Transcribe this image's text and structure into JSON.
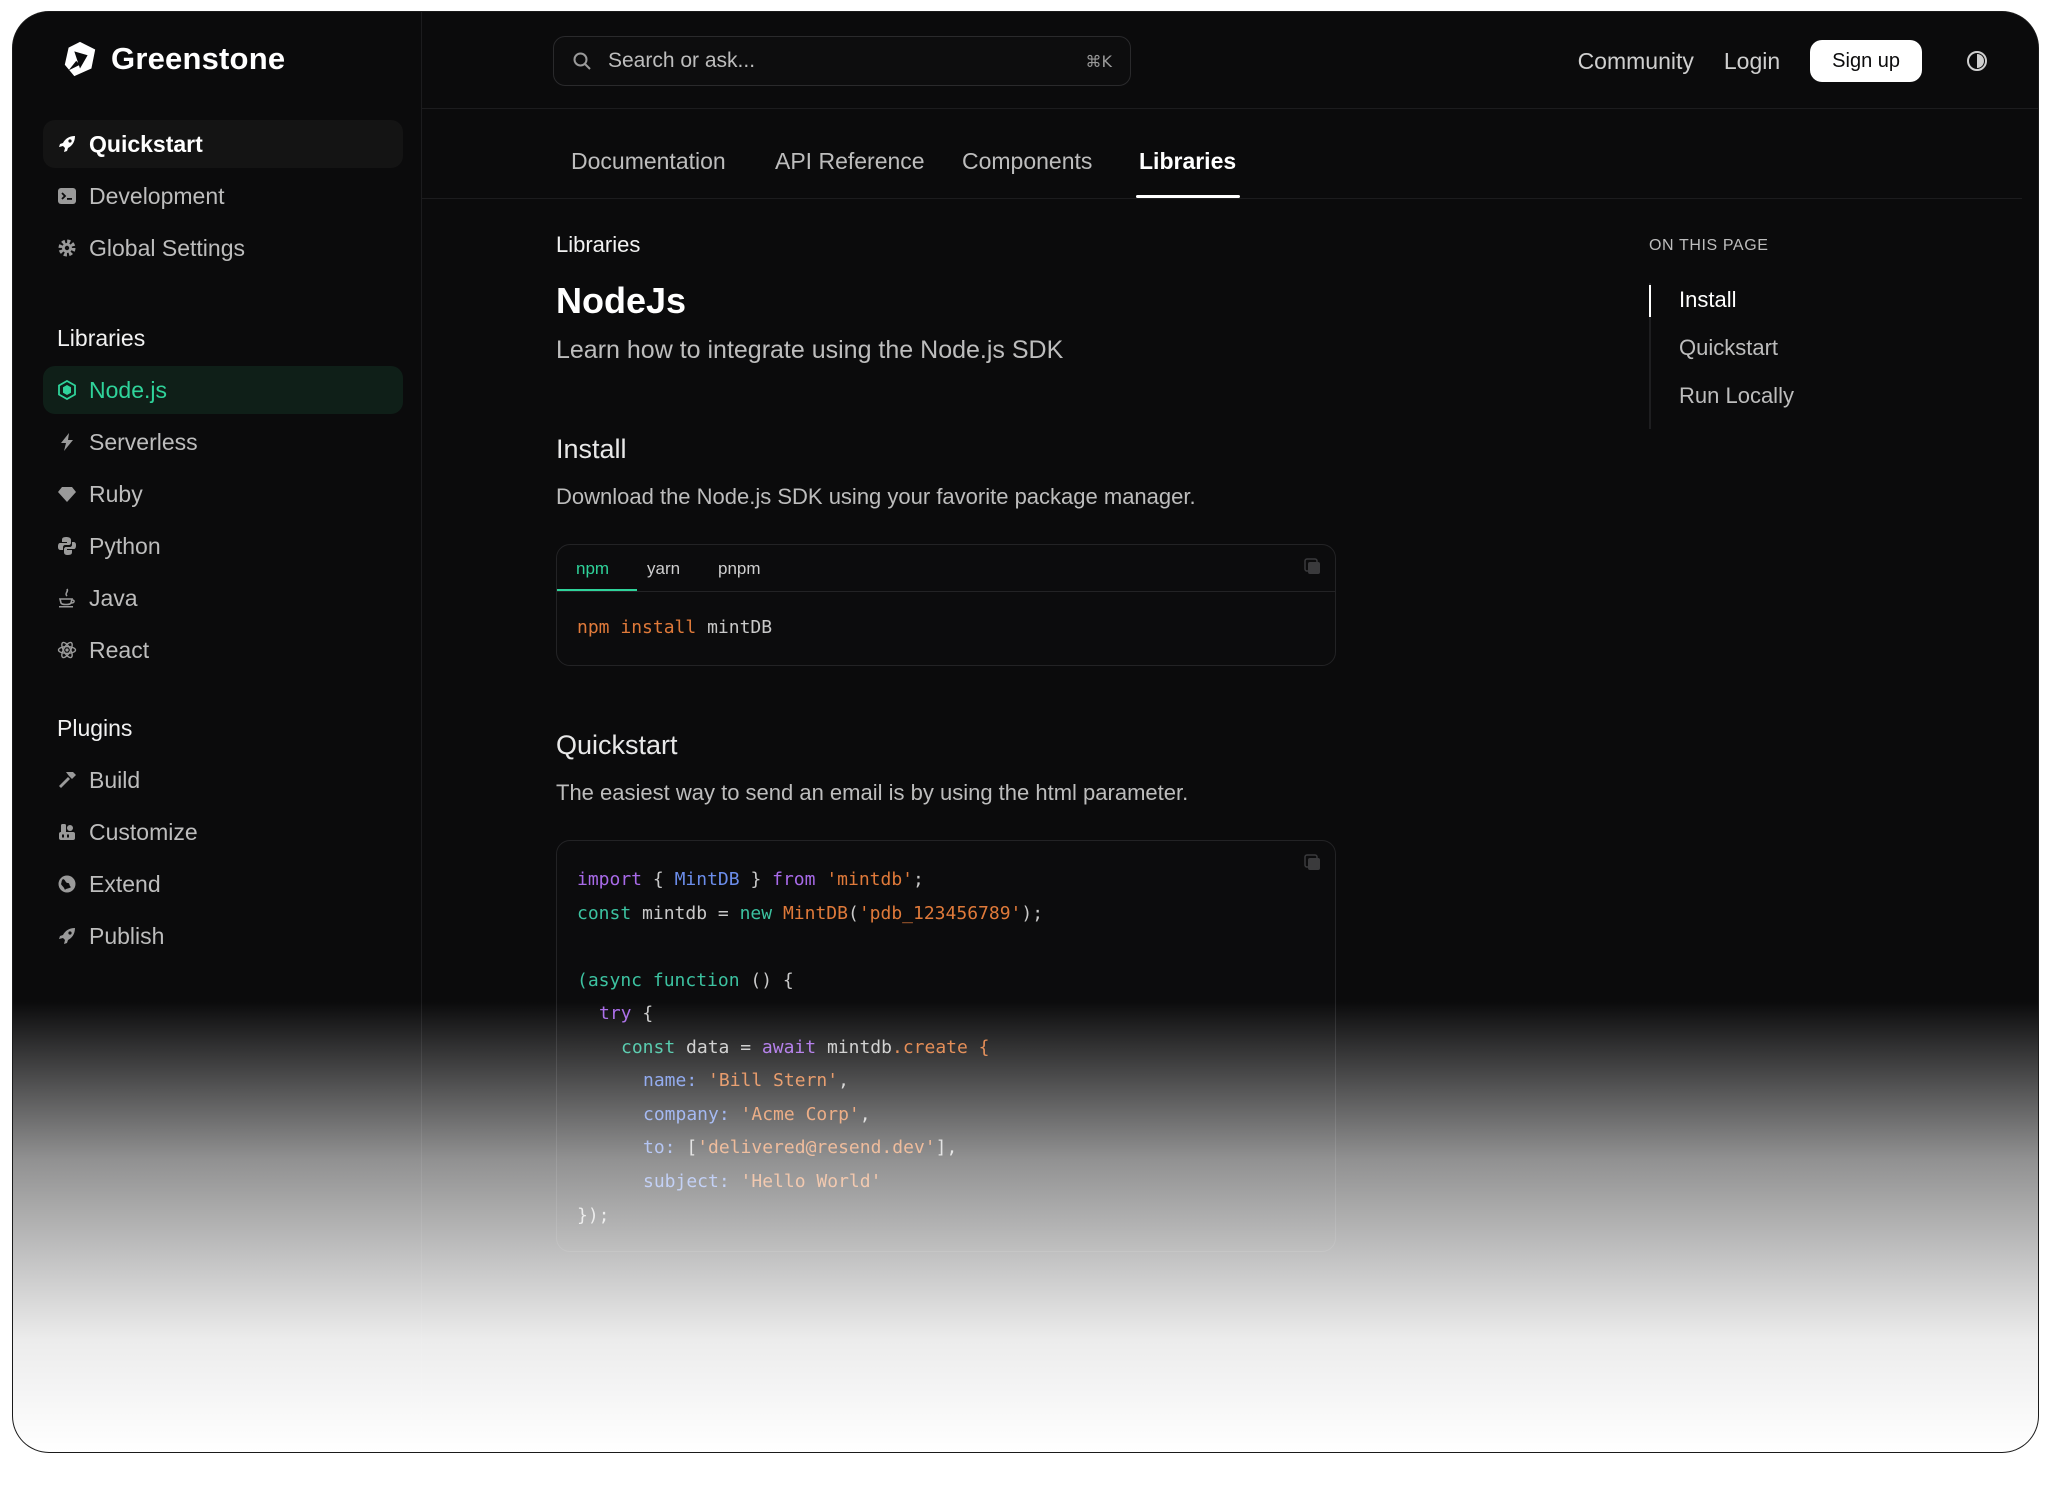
{
  "app": {
    "name": "Greenstone"
  },
  "sidebar": {
    "top_items": [
      {
        "label": "Quickstart",
        "icon": "rocket-icon"
      },
      {
        "label": "Development",
        "icon": "terminal-icon"
      },
      {
        "label": "Global Settings",
        "icon": "gear-icon"
      }
    ],
    "libraries": {
      "title": "Libraries",
      "items": [
        {
          "label": "Node.js",
          "icon": "nodejs-icon"
        },
        {
          "label": "Serverless",
          "icon": "bolt-icon"
        },
        {
          "label": "Ruby",
          "icon": "gem-icon"
        },
        {
          "label": "Python",
          "icon": "python-icon"
        },
        {
          "label": "Java",
          "icon": "java-icon"
        },
        {
          "label": "React",
          "icon": "react-icon"
        }
      ]
    },
    "plugins": {
      "title": "Plugins",
      "items": [
        {
          "label": "Build",
          "icon": "hammer-icon"
        },
        {
          "label": "Customize",
          "icon": "paint-icon"
        },
        {
          "label": "Extend",
          "icon": "globe-icon"
        },
        {
          "label": "Publish",
          "icon": "rocket-icon"
        }
      ]
    }
  },
  "header": {
    "search": {
      "placeholder": "Search or ask...",
      "shortcut": "⌘K"
    },
    "links": {
      "community": "Community",
      "login": "Login"
    },
    "signup_label": "Sign up"
  },
  "tabs": [
    {
      "label": "Documentation"
    },
    {
      "label": "API Reference"
    },
    {
      "label": "Components"
    },
    {
      "label": "Libraries"
    }
  ],
  "page": {
    "eyebrow": "Libraries",
    "title": "NodeJs",
    "subtitle": "Learn how to integrate using the Node.js SDK",
    "install": {
      "heading": "Install",
      "text": "Download the Node.js SDK using your favorite package manager.",
      "tabs": [
        "npm",
        "yarn",
        "pnpm"
      ],
      "command": {
        "tool": "npm",
        "verb": "install",
        "pkg": "mintDB"
      }
    },
    "quickstart": {
      "heading": "Quickstart",
      "text": "The easiest way to send an email is by using the html parameter.",
      "code": {
        "l1": {
          "import": "import",
          "open": "{",
          "name": "MintDB",
          "close": "}",
          "from": "from",
          "mod": "'mintdb'",
          "end": ";"
        },
        "l2": {
          "const": "const",
          "var": "mintdb",
          "eq": "=",
          "new": "new",
          "cls": "MintDB",
          "paren": "(",
          "key": "'pdb_123456789'",
          "end": ");"
        },
        "l3": {
          "open": "(async",
          "fn": "function",
          "rest": "() {"
        },
        "l4": {
          "try": "try",
          "brace": "{"
        },
        "l5": {
          "const": "const",
          "var": "data",
          "eq": "=",
          "await": "await",
          "obj": "mintdb",
          "method": ".create {"
        },
        "l6": {
          "key": "name:",
          "val": "'Bill Stern'",
          "end": ","
        },
        "l7": {
          "key": "company:",
          "val": "'Acme Corp'",
          "end": ","
        },
        "l8": {
          "key": "to:",
          "open": "[",
          "val": "'delivered@resend.dev'",
          "end": "],"
        },
        "l9": {
          "key": "subject:",
          "val": "'Hello World'"
        },
        "l10": {
          "close": "});"
        }
      }
    }
  },
  "toc": {
    "title": "ON THIS PAGE",
    "items": [
      {
        "label": "Install"
      },
      {
        "label": "Quickstart"
      },
      {
        "label": "Run Locally"
      }
    ]
  },
  "colors": {
    "accent": "#2fd39a",
    "background": "#0b0b0c"
  }
}
